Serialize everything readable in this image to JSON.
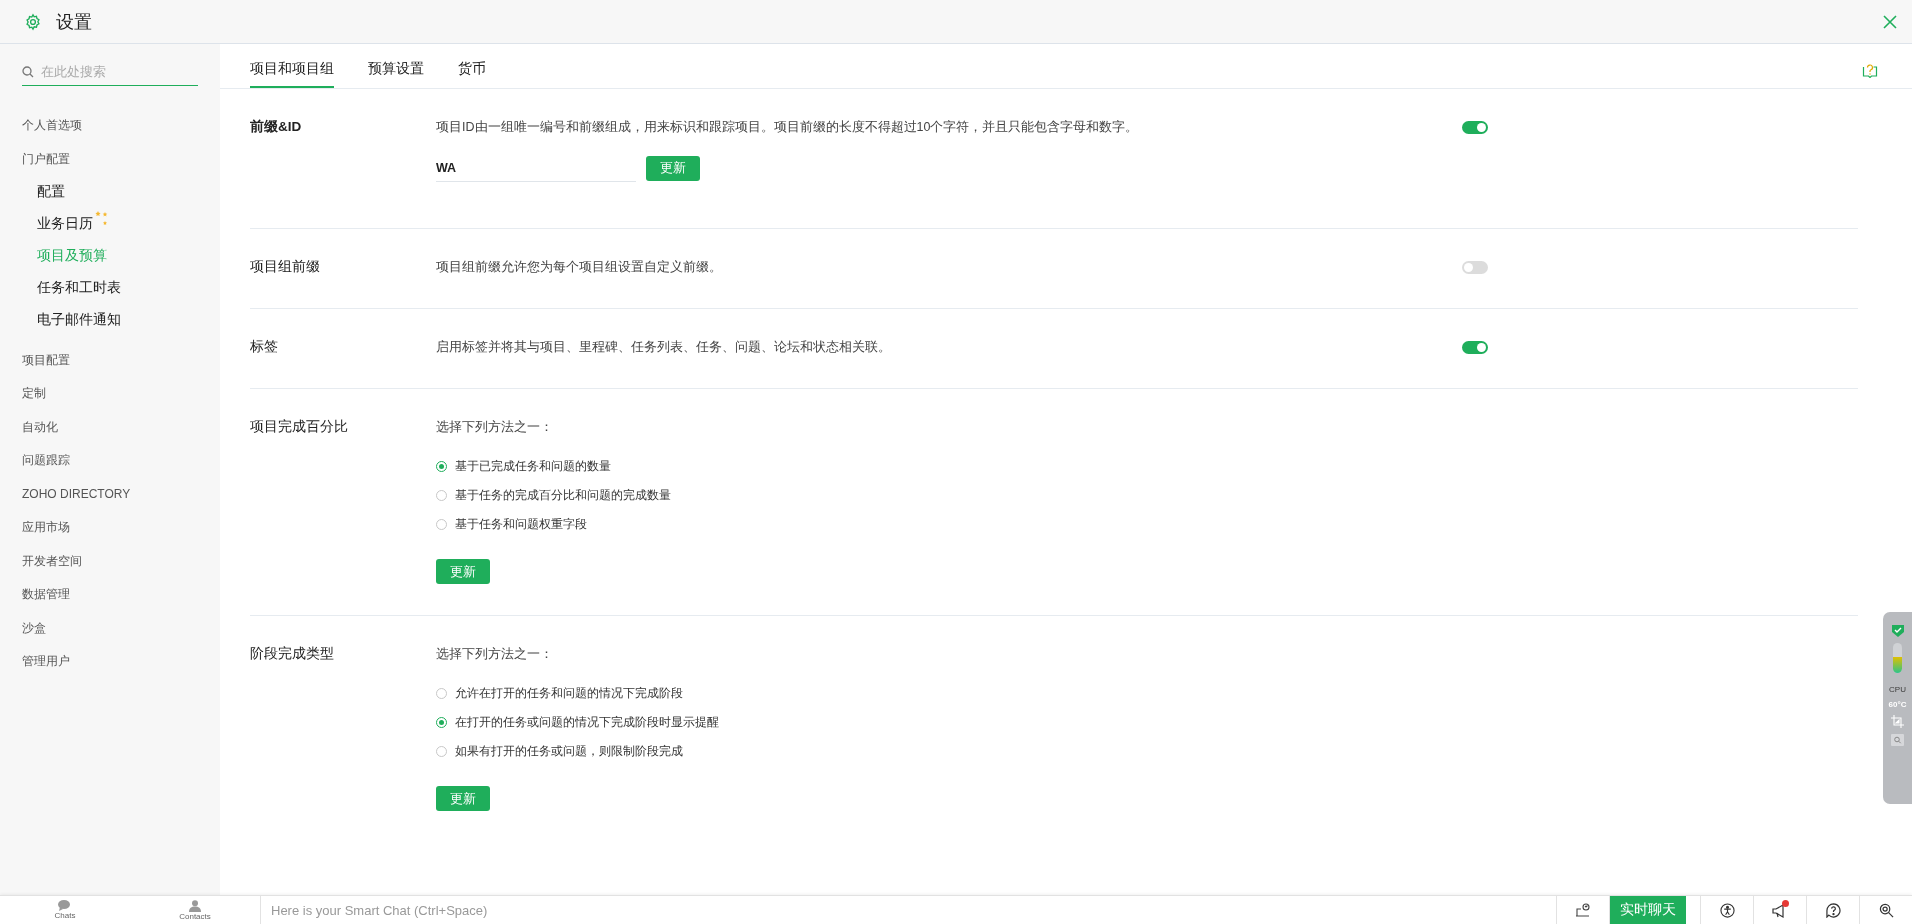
{
  "window": {
    "title": "设置"
  },
  "sidebar": {
    "search": {
      "placeholder": "在此处搜索"
    },
    "items": [
      {
        "label": "个人首选项",
        "selected": false
      },
      {
        "label": "门户配置",
        "selected": false,
        "children": [
          {
            "label": "配置",
            "selected": false,
            "new": false
          },
          {
            "label": "业务日历",
            "selected": false,
            "new": true
          },
          {
            "label": "项目及预算",
            "selected": true,
            "new": false
          },
          {
            "label": "任务和工时表",
            "selected": false,
            "new": false
          },
          {
            "label": "电子邮件通知",
            "selected": false,
            "new": false
          }
        ]
      },
      {
        "label": "项目配置",
        "selected": false
      },
      {
        "label": "定制",
        "selected": false
      },
      {
        "label": "自动化",
        "selected": false
      },
      {
        "label": "问题跟踪",
        "selected": false
      },
      {
        "label": "ZOHO DIRECTORY",
        "selected": false
      },
      {
        "label": "应用市场",
        "selected": false
      },
      {
        "label": "开发者空间",
        "selected": false
      },
      {
        "label": "数据管理",
        "selected": false
      },
      {
        "label": "沙盒",
        "selected": false
      },
      {
        "label": "管理用户",
        "selected": false
      }
    ]
  },
  "tabs": [
    {
      "label": "项目和项目组",
      "selected": true
    },
    {
      "label": "预算设置",
      "selected": false
    },
    {
      "label": "货币",
      "selected": false
    }
  ],
  "sections": [
    {
      "kind": "toggle",
      "title": "前缀&ID",
      "description": "项目ID由一组唯一编号和前缀组成，用来标识和跟踪项目。项目前缀的长度不得超过10个字符，并且只能包含字母和数字。",
      "on": true,
      "field": {
        "value": "WA"
      },
      "button": "更新"
    },
    {
      "kind": "toggle",
      "title": "项目组前缀",
      "description": "项目组前缀允许您为每个项目组设置自定义前缀。",
      "on": false
    },
    {
      "kind": "toggle",
      "title": "标签",
      "description": "启用标签并将其与项目、里程碑、任务列表、任务、问题、论坛和状态相关联。",
      "on": true
    },
    {
      "kind": "choice",
      "title": "项目完成百分比",
      "prompt": "选择下列方法之一：",
      "options": [
        {
          "label": "基于已完成任务和问题的数量",
          "selected": true
        },
        {
          "label": "基于任务的完成百分比和问题的完成数量",
          "selected": false
        },
        {
          "label": "基于任务和问题权重字段",
          "selected": false
        }
      ],
      "button": "更新"
    },
    {
      "kind": "choice",
      "title": "阶段完成类型",
      "prompt": "选择下列方法之一：",
      "options": [
        {
          "label": "允许在打开的任务和问题的情况下完成阶段",
          "selected": false
        },
        {
          "label": "在打开的任务或问题的情况下完成阶段时显示提醒",
          "selected": true
        },
        {
          "label": "如果有打开的任务或问题，则限制阶段完成",
          "selected": false
        }
      ],
      "button": "更新"
    }
  ],
  "monitor": {
    "label": "CPU",
    "temperature": "60°C"
  },
  "bottom_bar": {
    "nav": [
      {
        "label": "Chats"
      },
      {
        "label": "Contacts"
      }
    ],
    "chat_placeholder": "Here is your Smart Chat (Ctrl+Space)",
    "live_chat_button": "实时聊天",
    "unread": true
  }
}
